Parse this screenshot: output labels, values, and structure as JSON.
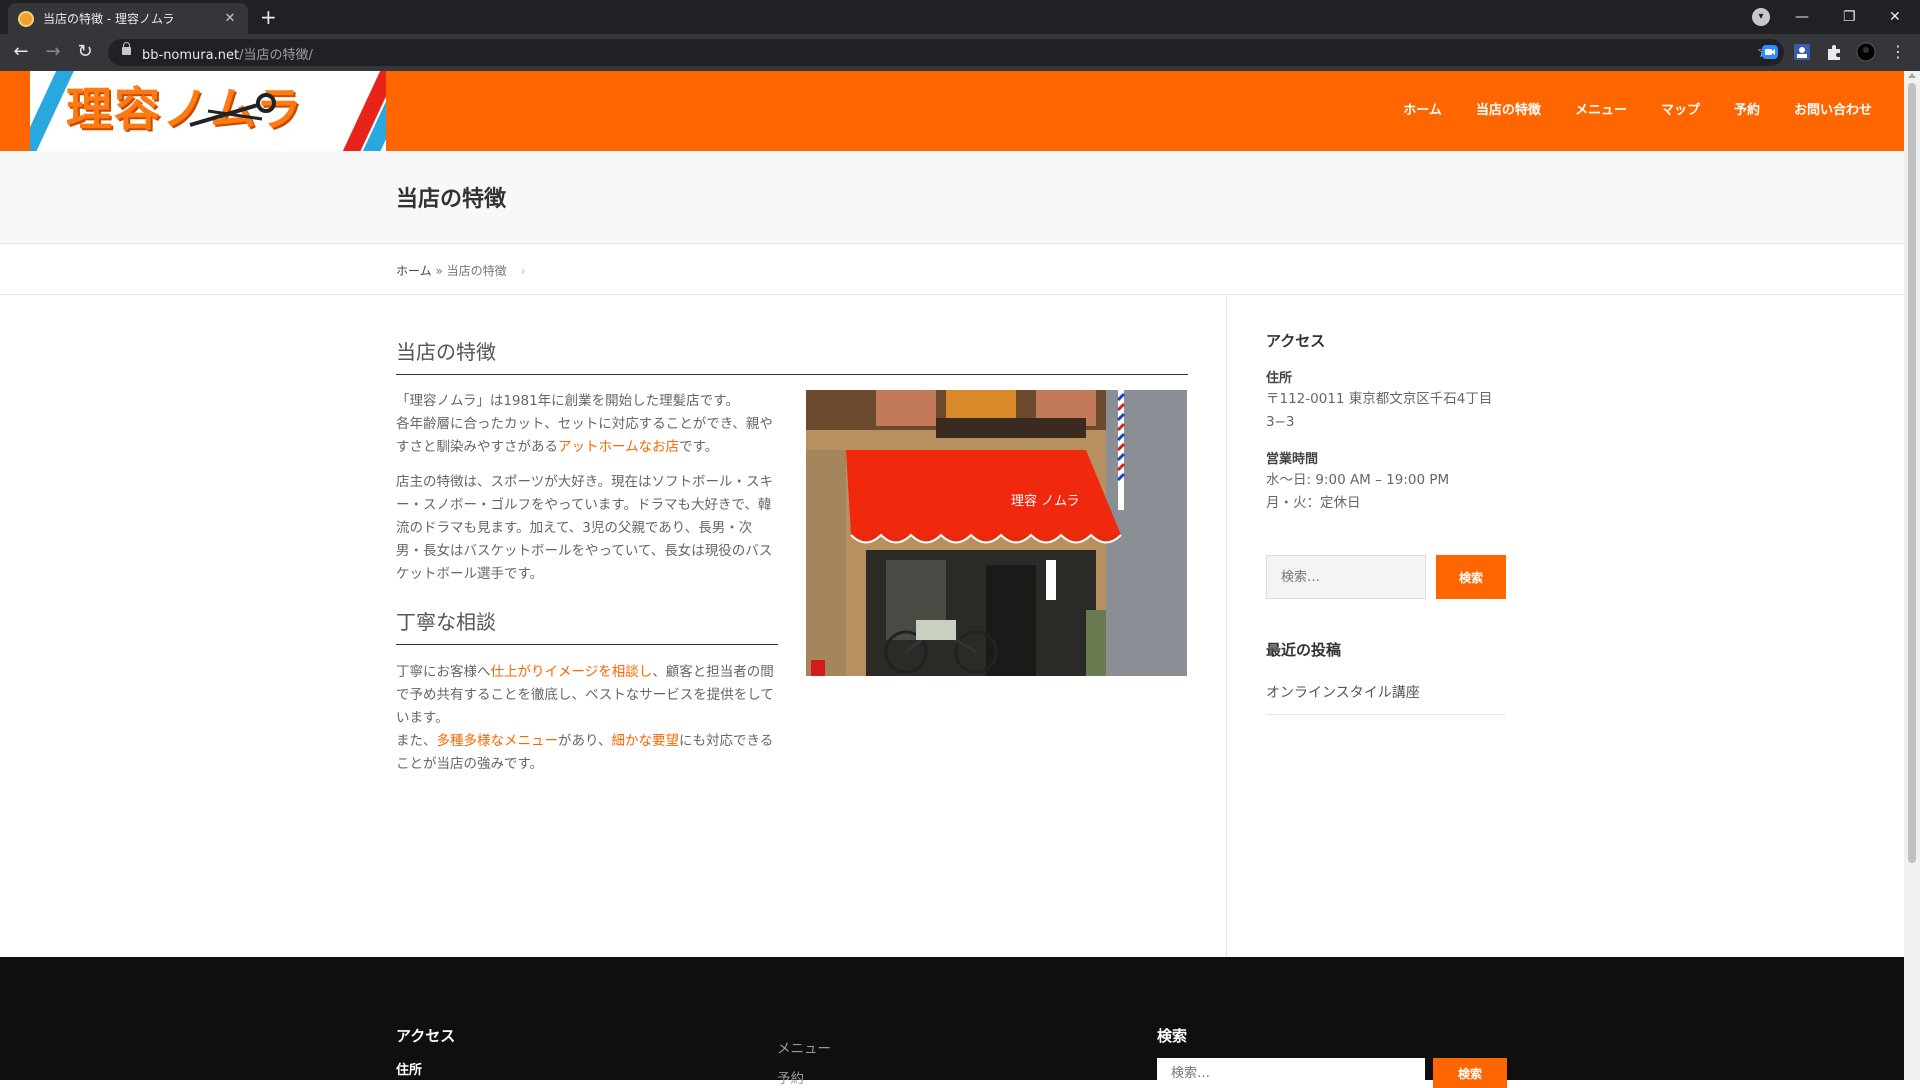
{
  "browser": {
    "tab_title": "当店の特徴 - 理容ノムラ",
    "tab_close": "✕",
    "new_tab": "+",
    "url_host": "bb-nomura.net",
    "url_path": "/当店の特徴/"
  },
  "header": {
    "logo_text": "理容ノムラ",
    "nav": [
      "ホーム",
      "当店の特徴",
      "メニュー",
      "マップ",
      "予約",
      "お問い合わせ"
    ],
    "brand_color": "#ff6600"
  },
  "page": {
    "title": "当店の特徴",
    "breadcrumb_home": "ホーム",
    "breadcrumb_sep": " » ",
    "breadcrumb_current": "当店の特徴"
  },
  "main": {
    "section1_heading": "当店の特徴",
    "p1_line1": "「理容ノムラ」は1981年に創業を開始した理髪店です。",
    "p1_line2_pre": "各年齢層に合ったカット、セットに対応することができ、親やすさと馴染みやすさがある",
    "p1_link": "アットホームなお店",
    "p1_line2_post": "です。",
    "p2": "店主の特徴は、スポーツが大好き。現在はソフトボール・スキー・スノボー・ゴルフをやっています。ドラマも大好きで、韓流のドラマも見ます。加えて、3児の父親であり、長男・次男・長女はバスケットボールをやっていて、長女は現役のバスケットボール選手です。",
    "section2_heading": "丁寧な相談",
    "p3_pre": "丁寧にお客様へ",
    "p3_link": "仕上がりイメージを相談し",
    "p3_post": "、顧客と担当者の間で予め共有することを徹底し、ベストなサービスを提供をしています。",
    "p4_pre": "また、",
    "p4_link1": "多種多様なメニュー",
    "p4_mid": "があり、",
    "p4_link2": "細かな要望",
    "p4_post": "にも対応できることが当店の強みです。",
    "photo_sign": "理容 ノムラ"
  },
  "sidebar": {
    "access_title": "アクセス",
    "address_label": "住所",
    "address_line1": "〒112-0011 東京都文京区千石4丁目",
    "address_line2": "3−3",
    "hours_label": "営業時間",
    "hours_line1": "水〜日: 9:00 AM – 19:00 PM",
    "hours_line2": "月・火：定休日",
    "search_placeholder": "検索…",
    "search_button": "検索",
    "recent_title": "最近の投稿",
    "recent_posts": [
      "オンラインスタイル講座"
    ]
  },
  "footer": {
    "access_title": "アクセス",
    "address_label": "住所",
    "links": [
      "メニュー",
      "予約"
    ],
    "search_title": "検索",
    "search_placeholder": "検索…",
    "search_button": "検索"
  }
}
